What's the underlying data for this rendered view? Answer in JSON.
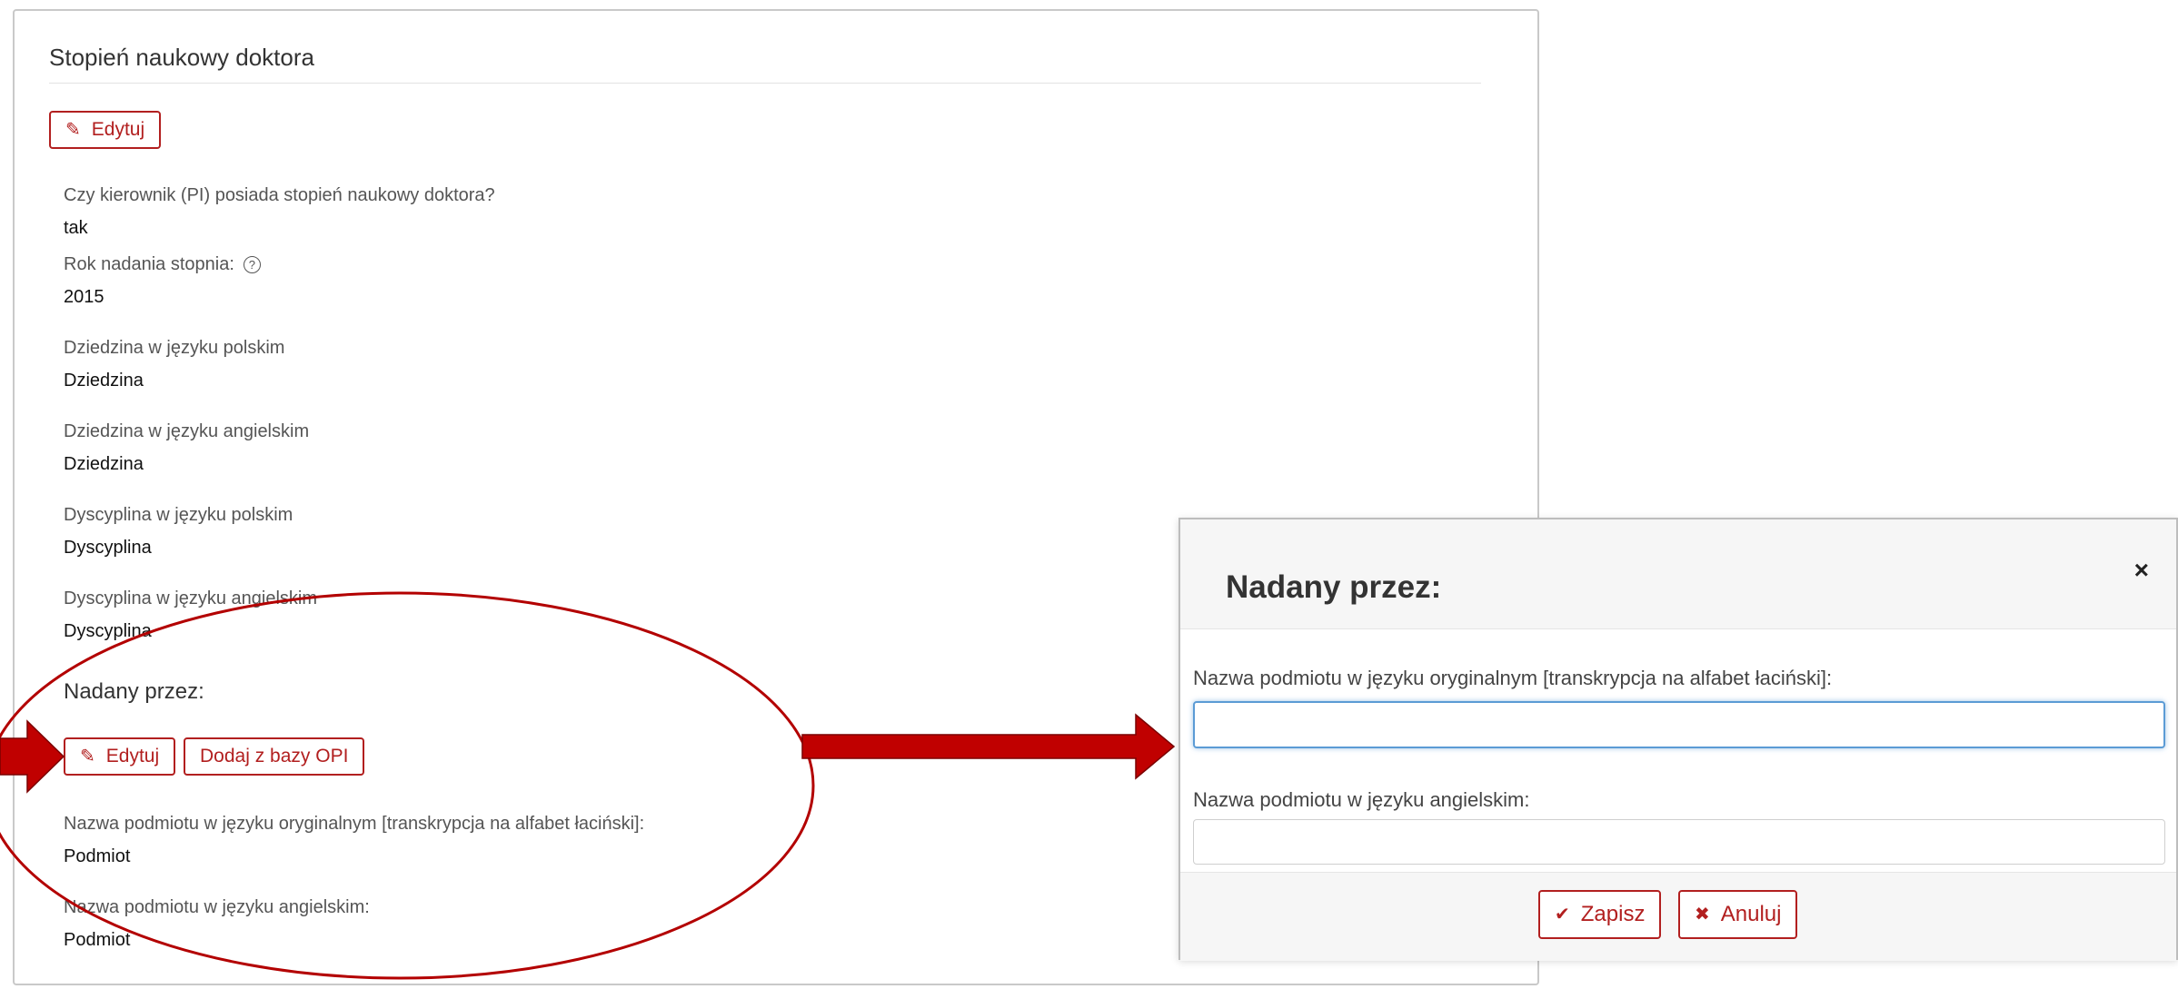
{
  "section": {
    "title": "Stopień naukowy doktora",
    "edit_label": "Edytuj"
  },
  "fields": [
    {
      "label": "Czy kierownik (PI) posiada stopień naukowy doktora?",
      "value": "tak"
    },
    {
      "label": "Rok nadania stopnia:",
      "value": "2015"
    },
    {
      "label": "Dziedzina w języku polskim",
      "value": "Dziedzina"
    },
    {
      "label": "Dziedzina w języku angielskim",
      "value": "Dziedzina"
    },
    {
      "label": "Dyscyplina w języku polskim",
      "value": "Dyscyplina"
    },
    {
      "label": "Dyscyplina w języku angielskim",
      "value": "Dyscyplina"
    }
  ],
  "nadany": {
    "heading": "Nadany przez:",
    "edit_label": "Edytuj",
    "opi_label": "Dodaj z bazy OPI",
    "fields": [
      {
        "label": "Nazwa podmiotu w języku oryginalnym [transkrypcja na alfabet łaciński]:",
        "value": "Podmiot"
      },
      {
        "label": "Nazwa podmiotu w języku angielskim:",
        "value": "Podmiot"
      }
    ]
  },
  "modal": {
    "title": "Nadany przez:",
    "close_icon": "×",
    "field1_label": "Nazwa podmiotu w języku oryginalnym [transkrypcja na alfabet łaciński]:",
    "field1_value": "",
    "field2_label": "Nazwa podmiotu w języku angielskim:",
    "field2_value": "",
    "save_label": "Zapisz",
    "cancel_label": "Anuluj"
  },
  "colors": {
    "accent": "#b21f1f",
    "arrow": "#b30000",
    "focus": "#5b9bd5"
  },
  "icons": {
    "edit": "pencil-icon",
    "help": "help-circle-icon",
    "save": "check-icon",
    "cancel": "x-icon"
  }
}
